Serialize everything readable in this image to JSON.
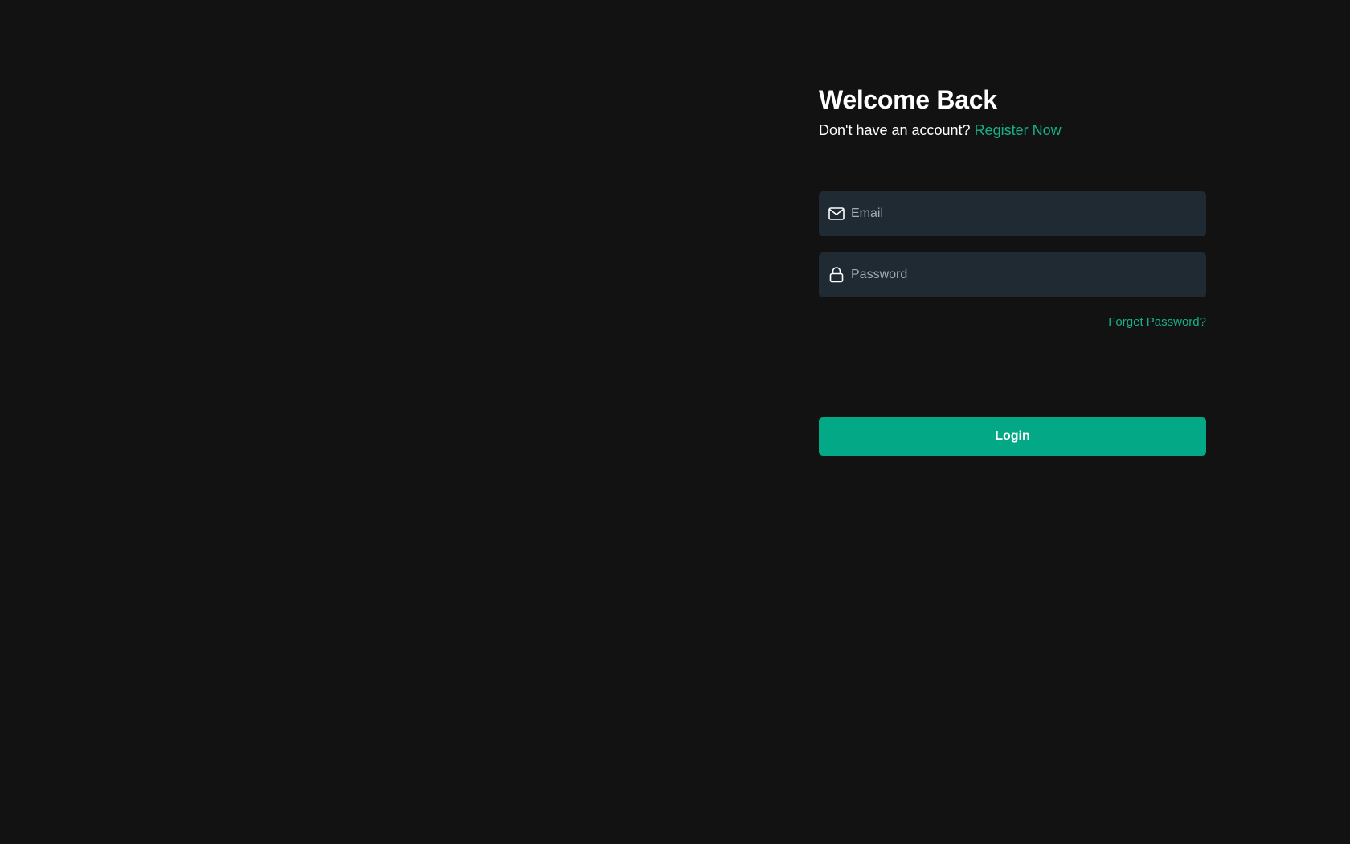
{
  "login": {
    "title": "Welcome Back",
    "subtitle_text": "Don't have an account?",
    "register_link": "Register Now",
    "email": {
      "placeholder": "Email",
      "value": "",
      "icon": "envelope-icon"
    },
    "password": {
      "placeholder": "Password",
      "value": "",
      "icon": "lock-icon"
    },
    "forgot_link": "Forget Password?",
    "login_button": "Login"
  },
  "colors": {
    "background": "#121212",
    "input_background": "#1f2a32",
    "accent": "#03a986",
    "link": "#16b08a",
    "placeholder": "#a3adb4"
  }
}
